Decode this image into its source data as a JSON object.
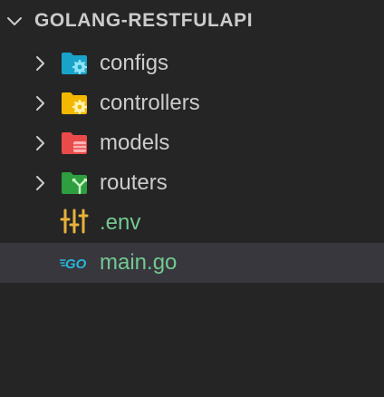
{
  "explorer": {
    "section_title": "GOLANG-RESTFULAPI",
    "colors": {
      "background": "#252526",
      "selected_row": "#37373d",
      "text": "#cccccc",
      "untracked_text": "#73c991",
      "configs_folder": "#1aa3c8",
      "controllers_folder": "#f5b800",
      "models_folder": "#e94a4a",
      "routers_folder": "#2e9e3f",
      "env_icon": "#e8b23a",
      "go_icon": "#29b6d8"
    },
    "items": [
      {
        "label": "configs",
        "type": "folder",
        "icon": "folder-config-icon"
      },
      {
        "label": "controllers",
        "type": "folder",
        "icon": "folder-controller-icon"
      },
      {
        "label": "models",
        "type": "folder",
        "icon": "folder-database-icon"
      },
      {
        "label": "routers",
        "type": "folder",
        "icon": "folder-routes-icon"
      },
      {
        "label": ".env",
        "type": "file",
        "icon": "env-settings-icon"
      },
      {
        "label": "main.go",
        "type": "file",
        "icon": "go-file-icon",
        "selected": true
      }
    ]
  }
}
